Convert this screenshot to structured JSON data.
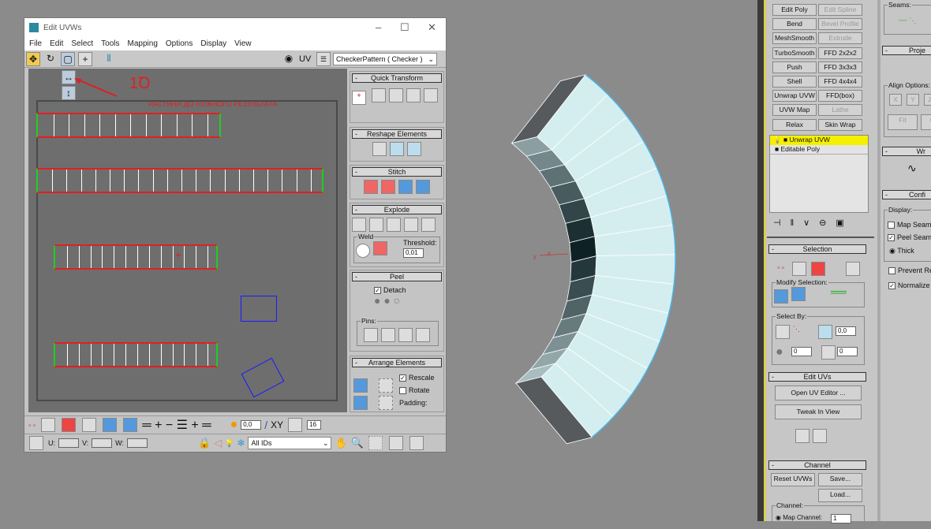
{
  "window": {
    "title": "Edit UVWs",
    "minimize": "–",
    "maximize": "☐",
    "close": "✕"
  },
  "menu": [
    "File",
    "Edit",
    "Select",
    "Tools",
    "Mapping",
    "Options",
    "Display",
    "View"
  ],
  "toolbar": {
    "uv_label": "UV",
    "texture_select": "CheckerPattern  ( Checker )"
  },
  "annotation": {
    "number": "1Ꝺ",
    "text": "РАСТЯНИ ДО НУЖНОГО РЕЗУЛЬТАТА"
  },
  "rollouts": {
    "quick_transform": "Quick Transform",
    "reshape": "Reshape Elements",
    "stitch": "Stitch",
    "explode": "Explode",
    "weld": "Weld",
    "threshold_label": "Threshold:",
    "threshold": "0,01",
    "peel": "Peel",
    "detach": "Detach",
    "pins": "Pins:",
    "arrange": "Arrange Elements",
    "rescale": "Rescale",
    "rotate": "Rotate",
    "padding": "Padding:"
  },
  "bottom": {
    "soft_value": "0,0",
    "xy": "XY",
    "grid_value": "16",
    "u": "U:",
    "v": "V:",
    "w": "W:",
    "ids": "All IDs"
  },
  "viewport": {
    "axis_x": "x",
    "axis_y": "y"
  },
  "modifiers": [
    [
      "Edit Poly",
      "Edit Spline"
    ],
    [
      "Bend",
      "Bevel Profile"
    ],
    [
      "MeshSmooth",
      "Extrude"
    ],
    [
      "TurboSmooth",
      "FFD 2x2x2"
    ],
    [
      "Push",
      "FFD 3x3x3"
    ],
    [
      "Shell",
      "FFD 4x4x4"
    ],
    [
      "Unwrap UVW",
      "FFD(box)"
    ],
    [
      "UVW Map",
      "Lathe"
    ],
    [
      "Relax",
      "Skin Wrap"
    ]
  ],
  "stack": [
    "Unwrap UVW",
    "Editable Poly"
  ],
  "selection": {
    "title": "Selection",
    "modify": "Modify Selection:",
    "select_by": "Select By:",
    "angle": "0,0",
    "v1": "0",
    "v2": "0"
  },
  "edit_uvs": {
    "title": "Edit UVs",
    "open": "Open UV Editor ...",
    "tweak": "Tweak In View"
  },
  "channel": {
    "title": "Channel",
    "reset": "Reset UVWs",
    "save": "Save...",
    "load": "Load...",
    "channel_label": "Channel:",
    "map_channel": "Map Channel:",
    "map_value": "1"
  },
  "right": {
    "seams": "Seams:",
    "projection": "Proje",
    "align": "Align Options:",
    "x": "X",
    "y": "Y",
    "z": "Z",
    "fit": "Fit",
    "c": "C",
    "wrap": "Wr",
    "config": "Confi",
    "display": "Display:",
    "map_seams": "Map Seams",
    "peel_seams": "Peel Seams",
    "thick": "Thick",
    "prevent": "Prevent Re",
    "normalize": "Normalize"
  }
}
